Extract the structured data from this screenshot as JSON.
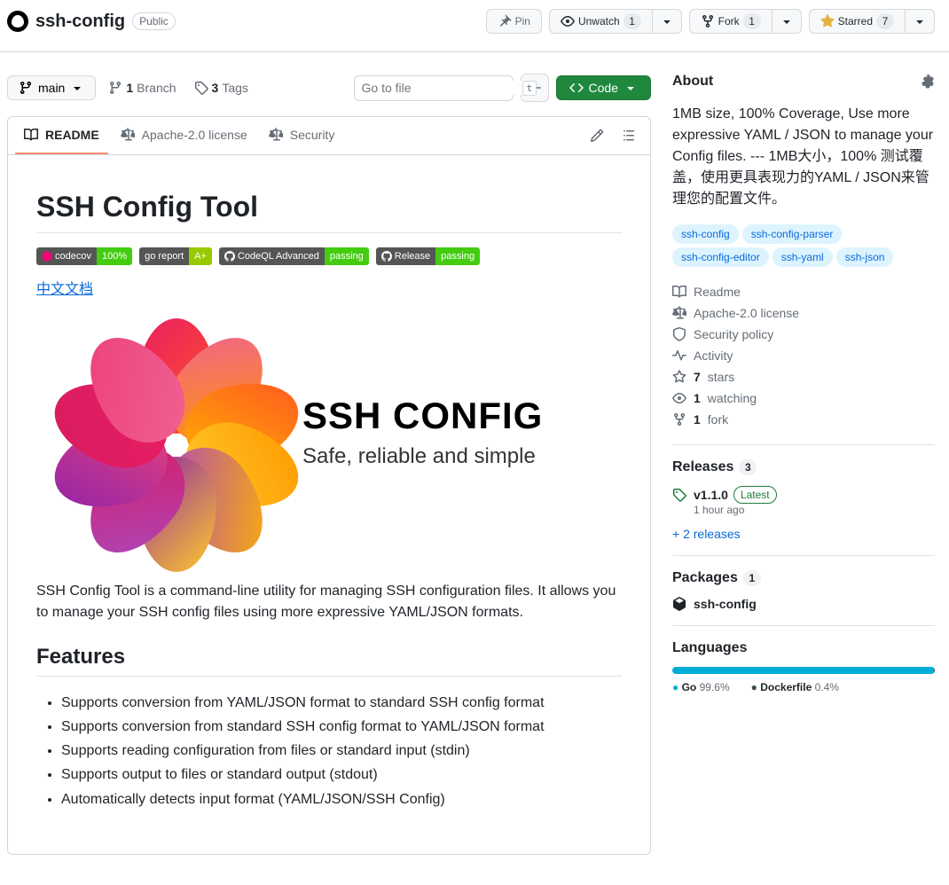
{
  "header": {
    "repo_name": "ssh-config",
    "visibility": "Public",
    "pin": "Pin",
    "unwatch": "Unwatch",
    "unwatch_count": "1",
    "fork": "Fork",
    "fork_count": "1",
    "starred": "Starred",
    "star_count": "7"
  },
  "filenav": {
    "branch": "main",
    "branches_count": "1",
    "branches_label": "Branch",
    "tags_count": "3",
    "tags_label": "Tags",
    "search_placeholder": "Go to file",
    "search_kbd": "t",
    "code_btn": "Code"
  },
  "tabs": {
    "readme": "README",
    "license": "Apache-2.0 license",
    "security": "Security"
  },
  "readme": {
    "h1": "SSH Config Tool",
    "badges": [
      {
        "left": "codecov",
        "right": "100%",
        "rc": "br-green",
        "icon": "cov"
      },
      {
        "left": "go report",
        "right": "A+",
        "rc": "br-lightgreen",
        "icon": ""
      },
      {
        "left": "CodeQL Advanced",
        "right": "passing",
        "rc": "br-green",
        "icon": "gh"
      },
      {
        "left": "Release",
        "right": "passing",
        "rc": "br-green",
        "icon": "gh"
      }
    ],
    "cn_link": "中文文档",
    "logo_title": "SSH CONFIG",
    "logo_tag": "Safe, reliable and simple",
    "intro": "SSH Config Tool is a command-line utility for managing SSH configuration files. It allows you to manage your SSH config files using more expressive YAML/JSON formats.",
    "h2_features": "Features",
    "features": [
      "Supports conversion from YAML/JSON format to standard SSH config format",
      "Supports conversion from standard SSH config format to YAML/JSON format",
      "Supports reading configuration from files or standard input (stdin)",
      "Supports output to files or standard output (stdout)",
      "Automatically detects input format (YAML/JSON/SSH Config)"
    ]
  },
  "about": {
    "title": "About",
    "description": "1MB size, 100% Coverage, Use more expressive YAML / JSON to manage your Config files. --- 1MB大小，100% 测试覆盖，使用更具表现力的YAML / JSON来管理您的配置文件。",
    "topics": [
      "ssh-config",
      "ssh-config-parser",
      "ssh-config-editor",
      "ssh-yaml",
      "ssh-json"
    ],
    "items": {
      "readme": "Readme",
      "license": "Apache-2.0 license",
      "security": "Security policy",
      "activity": "Activity",
      "stars_n": "7",
      "stars_l": "stars",
      "watch_n": "1",
      "watch_l": "watching",
      "fork_n": "1",
      "fork_l": "fork"
    }
  },
  "releases": {
    "title": "Releases",
    "count": "3",
    "latest_tag": "v1.1.0",
    "latest_label": "Latest",
    "latest_time": "1 hour ago",
    "more": "+ 2 releases"
  },
  "packages": {
    "title": "Packages",
    "count": "1",
    "name": "ssh-config"
  },
  "languages": {
    "title": "Languages",
    "go": {
      "name": "Go",
      "pct": "99.6%",
      "width": "99.6%"
    },
    "docker": {
      "name": "Dockerfile",
      "pct": "0.4%",
      "width": "0.4%"
    }
  }
}
